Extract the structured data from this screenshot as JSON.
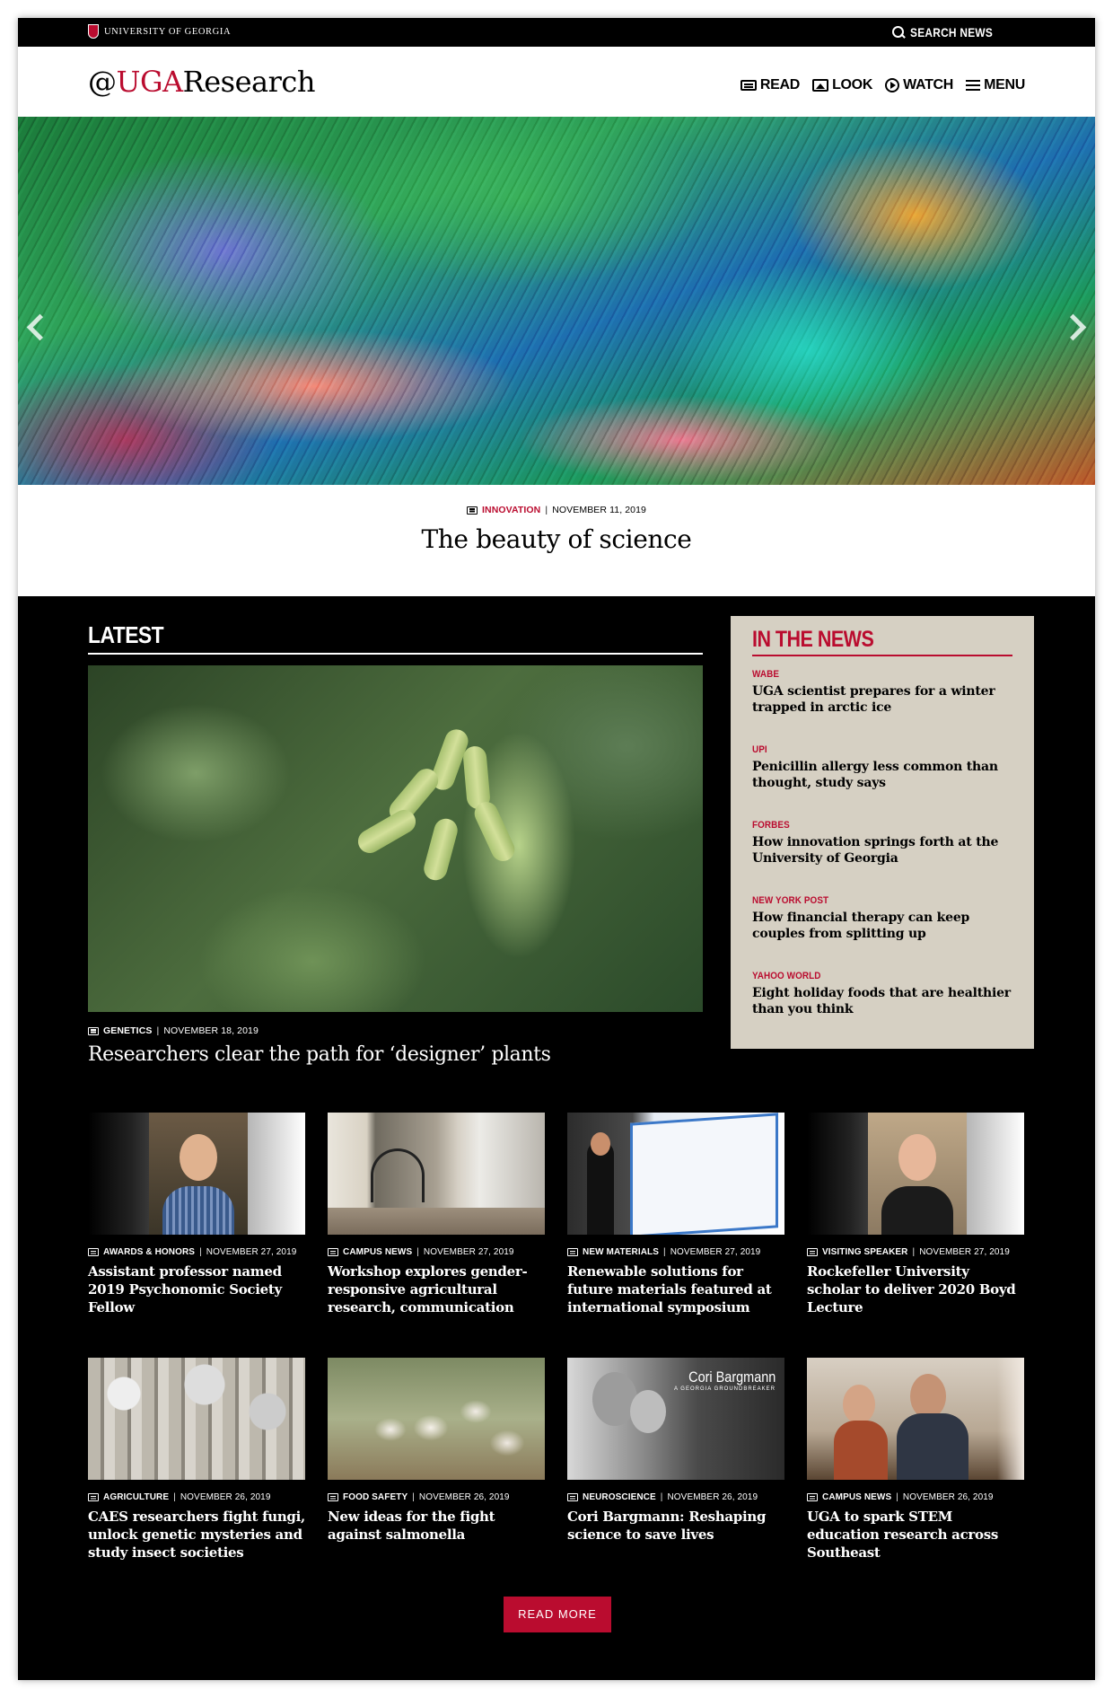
{
  "topbar": {
    "university": "UNIVERSITY OF GEORGIA",
    "search_label": "SEARCH NEWS"
  },
  "header": {
    "brand_at": "@",
    "brand_uga": "UGA",
    "brand_research": "Research",
    "nav": [
      {
        "label": "READ",
        "icon": "newspaper-icon"
      },
      {
        "label": "LOOK",
        "icon": "image-icon"
      },
      {
        "label": "WATCH",
        "icon": "play-icon"
      },
      {
        "label": "MENU",
        "icon": "hamburger-icon"
      }
    ]
  },
  "hero": {
    "category": "INNOVATION",
    "date": "NOVEMBER 11, 2019",
    "title": "The beauty of science"
  },
  "latest": {
    "heading": "LATEST",
    "featured": {
      "category": "GENETICS",
      "date": "NOVEMBER 18, 2019",
      "title": "Researchers clear the path for ‘designer’ plants"
    },
    "cards": [
      {
        "category": "AWARDS & HONORS",
        "date": "NOVEMBER 27, 2019",
        "title": "Assistant professor named 2019 Psychonomic Society Fellow"
      },
      {
        "category": "CAMPUS NEWS",
        "date": "NOVEMBER 27, 2019",
        "title": "Workshop explores gender-responsive agricultural research, communication"
      },
      {
        "category": "NEW MATERIALS",
        "date": "NOVEMBER 27, 2019",
        "title": "Renewable solutions for future materials featured at international symposium"
      },
      {
        "category": "VISITING SPEAKER",
        "date": "NOVEMBER 27, 2019",
        "title": "Rockefeller University scholar to deliver 2020 Boyd Lecture"
      },
      {
        "category": "AGRICULTURE",
        "date": "NOVEMBER 26, 2019",
        "title": "CAES researchers fight fungi, unlock genetic mysteries and study insect societies"
      },
      {
        "category": "FOOD SAFETY",
        "date": "NOVEMBER 26, 2019",
        "title": "New ideas for the fight against salmonella"
      },
      {
        "category": "NEUROSCIENCE",
        "date": "NOVEMBER 26, 2019",
        "title": "Cori Bargmann: Reshaping science to save lives"
      },
      {
        "category": "CAMPUS NEWS",
        "date": "NOVEMBER 26, 2019",
        "title": "UGA to spark STEM education research across Southeast"
      }
    ],
    "image_overlay": {
      "name": "Cori Bargmann",
      "subtitle": "A GEORGIA GROUNDBREAKER"
    }
  },
  "in_the_news": {
    "heading": "IN THE NEWS",
    "items": [
      {
        "source": "WABE",
        "headline": "UGA scientist prepares for a winter trapped in arctic ice"
      },
      {
        "source": "UPI",
        "headline": "Penicillin allergy less common than thought, study says"
      },
      {
        "source": "FORBES",
        "headline": "How innovation springs forth at the University of Georgia"
      },
      {
        "source": "NEW YORK POST",
        "headline": "How financial therapy can keep couples from splitting up"
      },
      {
        "source": "YAHOO WORLD",
        "headline": "Eight holiday foods that are healthier than you think"
      }
    ]
  },
  "read_more": "READ MORE",
  "colors": {
    "accent": "#ba0c2f",
    "news_bg": "#d6d0c3",
    "page_bg": "#000000"
  }
}
